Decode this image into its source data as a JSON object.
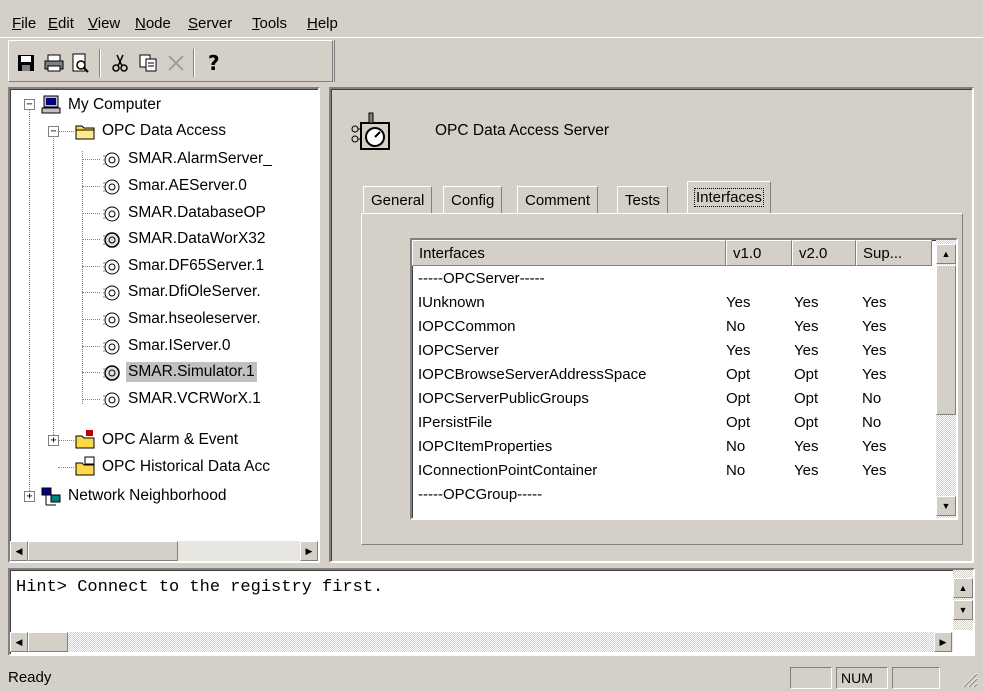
{
  "menu": [
    "File",
    "Edit",
    "View",
    "Node",
    "Server",
    "Tools",
    "Help"
  ],
  "menu_underline_chars": [
    "F",
    "E",
    "V",
    "N",
    "S",
    "T",
    "H"
  ],
  "toolbar": {
    "buttons": [
      "save-icon",
      "print-icon",
      "print-preview-icon",
      "cut-icon",
      "copy-icon",
      "delete-icon",
      "help-icon"
    ]
  },
  "tree": {
    "root": "My Computer",
    "opc_da": "OPC Data Access",
    "servers": [
      "SMAR.AlarmServer_",
      "Smar.AEServer.0",
      "SMAR.DatabaseOP",
      "SMAR.DataWorX32",
      "Smar.DF65Server.1",
      "Smar.DfiOleServer.",
      "Smar.hseoleserver.",
      "Smar.IServer.0",
      "SMAR.Simulator.1",
      "SMAR.VCRWorX.1"
    ],
    "selected_server": "SMAR.Simulator.1",
    "opc_ae": "OPC Alarm & Event",
    "opc_hda": "OPC Historical Data Acc",
    "network": "Network Neighborhood"
  },
  "server_panel": {
    "title": "OPC Data Access Server",
    "tabs": [
      "General",
      "Config",
      "Comment",
      "Tests",
      "Interfaces"
    ],
    "active_tab": "Interfaces"
  },
  "interfaces_table": {
    "columns": [
      "Interfaces",
      "v1.0",
      "v2.0",
      "Sup..."
    ],
    "rows": [
      [
        "-----OPCServer-----",
        "",
        "",
        ""
      ],
      [
        "IUnknown",
        "Yes",
        "Yes",
        "Yes"
      ],
      [
        "IOPCCommon",
        "No",
        "Yes",
        "Yes"
      ],
      [
        "IOPCServer",
        "Yes",
        "Yes",
        "Yes"
      ],
      [
        "IOPCBrowseServerAddressSpace",
        "Opt",
        "Opt",
        "Yes"
      ],
      [
        "IOPCServerPublicGroups",
        "Opt",
        "Opt",
        "No"
      ],
      [
        "IPersistFile",
        "Opt",
        "Opt",
        "No"
      ],
      [
        "IOPCItemProperties",
        "No",
        "Yes",
        "Yes"
      ],
      [
        "IConnectionPointContainer",
        "No",
        "Yes",
        "Yes"
      ],
      [
        "-----OPCGroup-----",
        "",
        "",
        ""
      ]
    ]
  },
  "hint": "Hint> Connect to the registry first.",
  "status": {
    "text": "Ready",
    "num": "NUM"
  }
}
